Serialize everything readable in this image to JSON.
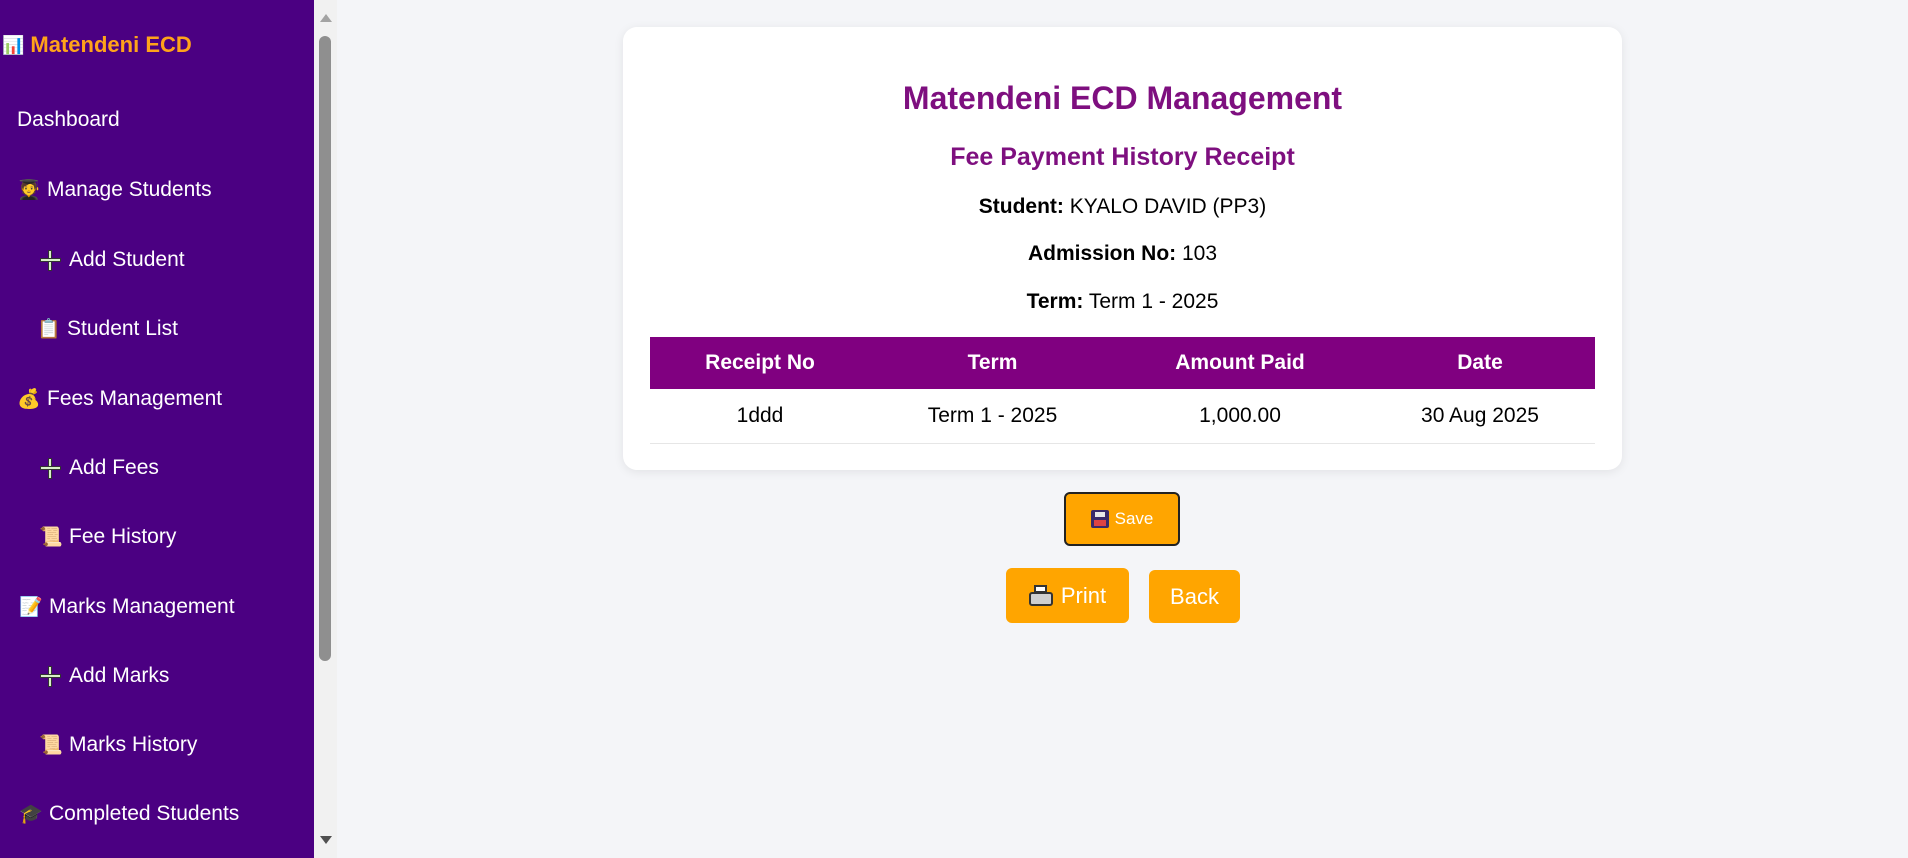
{
  "sidebar": {
    "brand": {
      "icon": "📊",
      "label": "Matendeni ECD"
    },
    "items": [
      {
        "icon": "",
        "label": "Dashboard"
      },
      {
        "icon": "🧑‍🎓",
        "label": "Manage Students"
      },
      {
        "icon": "plus-icon",
        "label": "Add Student"
      },
      {
        "icon": "📋",
        "label": "Student List"
      },
      {
        "icon": "💰",
        "label": "Fees Management"
      },
      {
        "icon": "plus-icon",
        "label": "Add Fees"
      },
      {
        "icon": "📜",
        "label": "Fee History"
      },
      {
        "icon": "📝",
        "label": "Marks Management"
      },
      {
        "icon": "plus-icon",
        "label": "Add Marks"
      },
      {
        "icon": "📜",
        "label": "Marks History"
      },
      {
        "icon": "🎓",
        "label": "Completed Students"
      }
    ]
  },
  "receipt": {
    "org_title": "Matendeni ECD Management",
    "title": "Fee Payment History Receipt",
    "student_label": "Student:",
    "student_value": "KYALO DAVID (PP3)",
    "admission_label": "Admission No:",
    "admission_value": "103",
    "term_label": "Term:",
    "term_value": "Term 1 - 2025",
    "table": {
      "headers": [
        "Receipt No",
        "Term",
        "Amount Paid",
        "Date"
      ],
      "rows": [
        [
          "1ddd",
          "Term 1 - 2025",
          "1,000.00",
          "30 Aug 2025"
        ]
      ]
    }
  },
  "actions": {
    "save_icon": "💾",
    "save_label": "Save",
    "print_label": "Print",
    "back_label": "Back"
  },
  "colors": {
    "sidebar_bg": "#4b0082",
    "brand": "#ffa31a",
    "title": "#7e0f7f",
    "table_header": "#800080",
    "button": "#ffa500"
  }
}
